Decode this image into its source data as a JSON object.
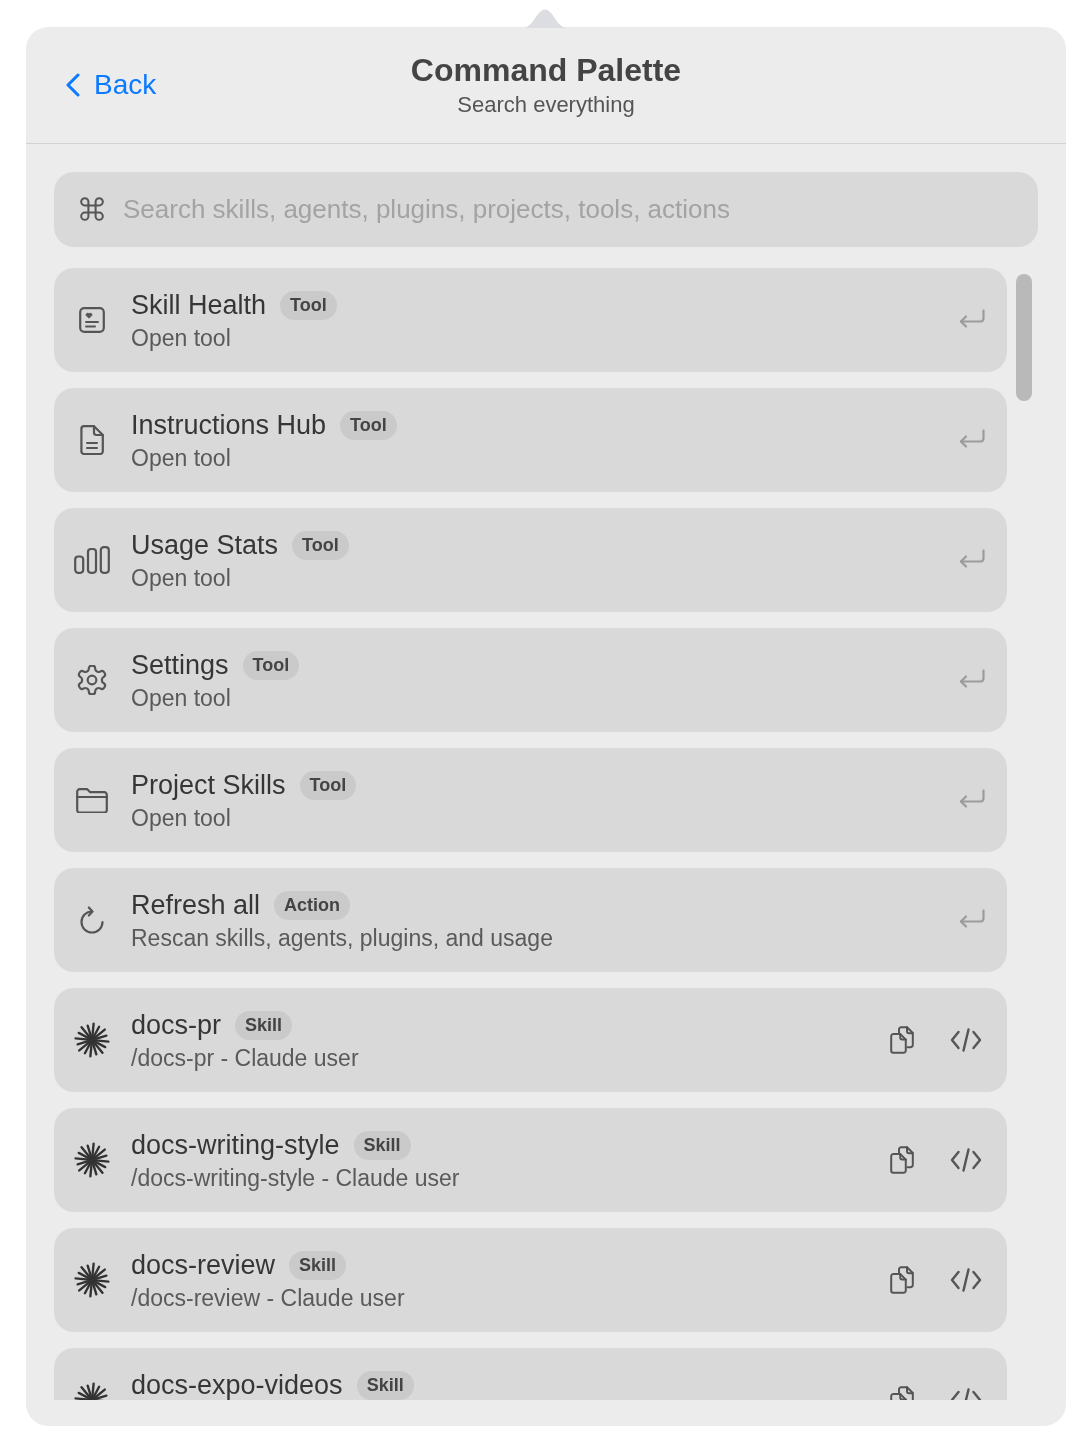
{
  "header": {
    "back": "Back",
    "title": "Command Palette",
    "subtitle": "Search everything"
  },
  "search": {
    "placeholder": "Search skills, agents, plugins, projects, tools, actions"
  },
  "items": [
    {
      "kind": "tool",
      "title": "Skill Health",
      "badge": "Tool",
      "subtitle": "Open tool"
    },
    {
      "kind": "tool",
      "title": "Instructions Hub",
      "badge": "Tool",
      "subtitle": "Open tool"
    },
    {
      "kind": "tool",
      "title": "Usage Stats",
      "badge": "Tool",
      "subtitle": "Open tool"
    },
    {
      "kind": "tool",
      "title": "Settings",
      "badge": "Tool",
      "subtitle": "Open tool"
    },
    {
      "kind": "tool",
      "title": "Project Skills",
      "badge": "Tool",
      "subtitle": "Open tool"
    },
    {
      "kind": "action",
      "title": "Refresh all",
      "badge": "Action",
      "subtitle": "Rescan skills, agents, plugins, and usage"
    },
    {
      "kind": "skill",
      "title": "docs-pr",
      "badge": "Skill",
      "subtitle": "/docs-pr - Claude user"
    },
    {
      "kind": "skill",
      "title": "docs-writing-style",
      "badge": "Skill",
      "subtitle": "/docs-writing-style - Claude user"
    },
    {
      "kind": "skill",
      "title": "docs-review",
      "badge": "Skill",
      "subtitle": "/docs-review - Claude user"
    },
    {
      "kind": "skill",
      "title": "docs-expo-videos",
      "badge": "Skill"
    }
  ]
}
